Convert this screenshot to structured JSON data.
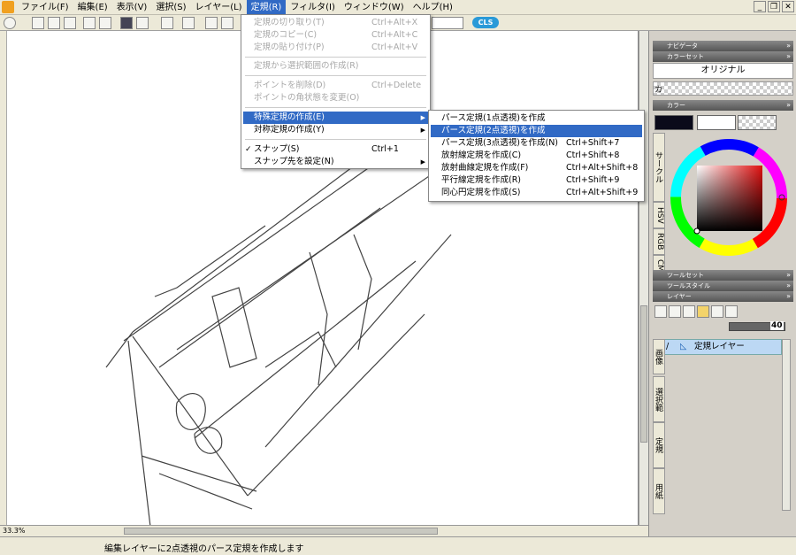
{
  "menubar": {
    "items": [
      "ファイル(F)",
      "編集(E)",
      "表示(V)",
      "選択(S)",
      "レイヤー(L)",
      "定規(R)",
      "フィルタ(I)",
      "ウィンドウ(W)",
      "ヘルプ(H)"
    ],
    "active_index": 5
  },
  "window_controls": [
    "_",
    "❐",
    "✕"
  ],
  "toolbar": {
    "logo": "CLS"
  },
  "ruler_menu": {
    "items": [
      {
        "label": "定規の切り取り(T)",
        "shortcut": "Ctrl+Alt+X",
        "disabled": true
      },
      {
        "label": "定規のコピー(C)",
        "shortcut": "Ctrl+Alt+C",
        "disabled": true
      },
      {
        "label": "定規の貼り付け(P)",
        "shortcut": "Ctrl+Alt+V",
        "disabled": true
      },
      {
        "label": "定規から選択範囲の作成(R)",
        "shortcut": "",
        "disabled": true
      },
      {
        "label": "ポイントを削除(D)",
        "shortcut": "Ctrl+Delete",
        "disabled": true
      },
      {
        "label": "ポイントの角状態を変更(O)",
        "shortcut": "",
        "disabled": true
      },
      {
        "label": "特殊定規の作成(E)",
        "shortcut": "",
        "highlight": true,
        "submenu": true
      },
      {
        "label": "対称定規の作成(Y)",
        "shortcut": "",
        "submenu": true
      },
      {
        "label": "スナップ(S)",
        "shortcut": "Ctrl+1",
        "checked": true
      },
      {
        "label": "スナップ先を設定(N)",
        "shortcut": "",
        "submenu": true
      }
    ]
  },
  "special_ruler_submenu": {
    "items": [
      {
        "label": "パース定規(1点透視)を作成",
        "shortcut": ""
      },
      {
        "label": "パース定規(2点透視)を作成",
        "shortcut": "",
        "highlight": true
      },
      {
        "label": "パース定規(3点透視)を作成(N)",
        "shortcut": "Ctrl+Shift+7"
      },
      {
        "label": "放射線定規を作成(C)",
        "shortcut": "Ctrl+Shift+8"
      },
      {
        "label": "放射曲線定規を作成(F)",
        "shortcut": "Ctrl+Alt+Shift+8"
      },
      {
        "label": "平行線定規を作成(R)",
        "shortcut": "Ctrl+Shift+9"
      },
      {
        "label": "同心円定規を作成(S)",
        "shortcut": "Ctrl+Alt+Shift+9"
      }
    ]
  },
  "panels": {
    "navigator": "ナビゲータ",
    "colorset": "カラーセット",
    "colorset_value": "オリジナル",
    "colorset_label": "カ",
    "color": "カラー",
    "color_tabs": [
      "サークル",
      "HSV",
      "RGB",
      "CMY"
    ],
    "toolset": "ツールセット",
    "toolstyle": "ツールスタイル",
    "layer": "レイヤー",
    "opacity": "40",
    "layer_name": "定規レイヤー",
    "layer_tabs": [
      "画像",
      "選択範",
      "定規",
      "用紙"
    ]
  },
  "zoom": "33.3%",
  "status": "編集レイヤーに2点透視のパース定規を作成します",
  "colors": {
    "accent": "#316ac5",
    "fg_color": "#0a0a1a",
    "bg_color": "#ffffff"
  }
}
